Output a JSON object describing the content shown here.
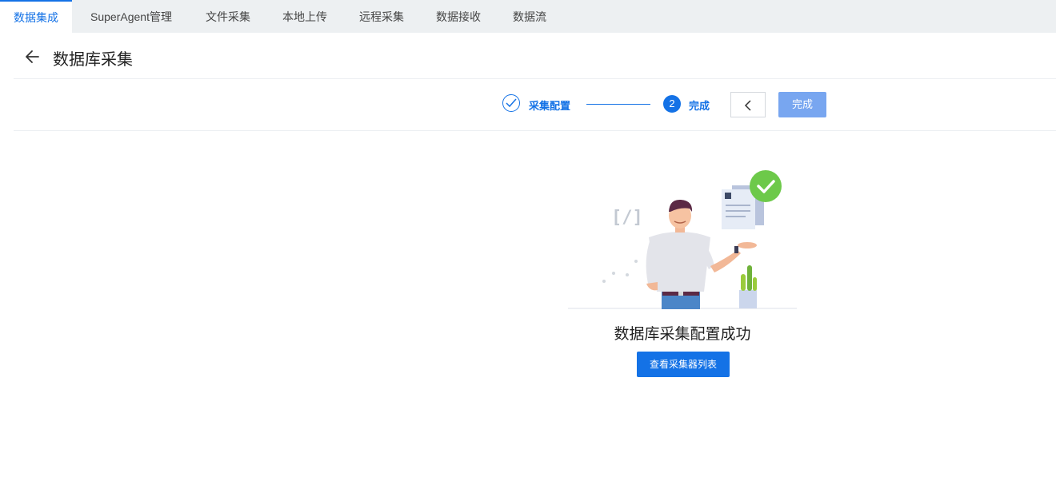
{
  "tabs": [
    {
      "label": "数据集成",
      "active": true
    },
    {
      "label": "SuperAgent管理",
      "active": false
    },
    {
      "label": "文件采集",
      "active": false
    },
    {
      "label": "本地上传",
      "active": false
    },
    {
      "label": "远程采集",
      "active": false
    },
    {
      "label": "数据接收",
      "active": false
    },
    {
      "label": "数据流",
      "active": false
    }
  ],
  "header": {
    "title": "数据库采集",
    "back_icon": "arrow-left-icon"
  },
  "steps": [
    {
      "label": "采集配置",
      "status": "done"
    },
    {
      "label": "完成",
      "number": "2",
      "status": "current"
    }
  ],
  "actions": {
    "finish_label": "完成",
    "prev_icon": "chevron-left-icon"
  },
  "result": {
    "title": "数据库采集配置成功",
    "button_label": "查看采集器列表"
  },
  "colors": {
    "accent": "#1472e6",
    "success": "#6dc94a",
    "finish_disabled": "#78a6f0"
  }
}
